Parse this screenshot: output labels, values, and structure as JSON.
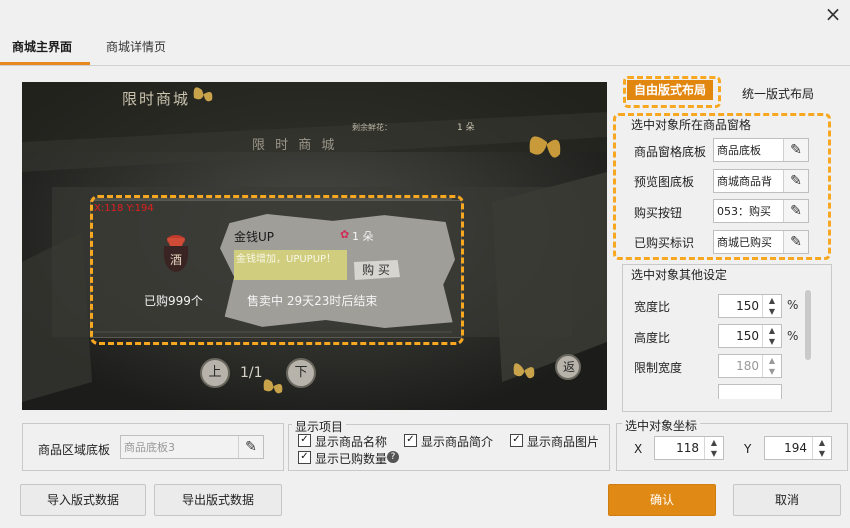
{
  "tabs": {
    "main": "商城主界面",
    "detail": "商城详情页"
  },
  "window": {
    "close_icon": "×"
  },
  "preview": {
    "shop_title": "限时商城",
    "shop_subtitle": "限 时 商 城",
    "remain_label": "剩余鲜花：",
    "remain_value": "1 朵",
    "coords": "X:118 Y:194",
    "item_icon_char": "酒",
    "bought": "已购999个",
    "item_name": "金钱UP",
    "item_price": "1 朵",
    "item_desc": "金钱增加，UPUPUP！",
    "buy": "购 买",
    "sale_time": "售卖中  29天23时后结束",
    "page": "1/1",
    "prev": "上",
    "next": "下",
    "back": "返"
  },
  "right_panel": {
    "tab_free": "自由版式布局",
    "tab_unified": "统一版式布局",
    "cell_group_title": "选中对象所在商品窗格",
    "cell_rows": [
      {
        "label": "商品窗格底板",
        "value": "商品底板"
      },
      {
        "label": "预览图底板",
        "value": "商城商品背"
      },
      {
        "label": "购买按钮",
        "value": "053：购买"
      },
      {
        "label": "已购买标识",
        "value": "商城已购买"
      }
    ],
    "other_group_title": "选中对象其他设定",
    "width_label": "宽度比",
    "width_value": "150",
    "width_unit": "%",
    "height_label": "高度比",
    "height_value": "150",
    "height_unit": "%",
    "limit_label": "限制宽度",
    "limit_value": "180"
  },
  "bottom": {
    "area_label": "商品区域底板",
    "area_value": "商品底板3",
    "display_title": "显示项目",
    "cb_name": "显示商品名称",
    "cb_intro": "显示商品简介",
    "cb_image": "显示商品图片",
    "cb_bought": "显示已购数量",
    "coord_title": "选中对象坐标",
    "x_label": "X",
    "x_value": "118",
    "y_label": "Y",
    "y_value": "194",
    "import": "导入版式数据",
    "export": "导出版式数据",
    "ok": "确认",
    "cancel": "取消"
  },
  "colors": {
    "accent": "#e08914",
    "highlight": "#f7a820"
  }
}
